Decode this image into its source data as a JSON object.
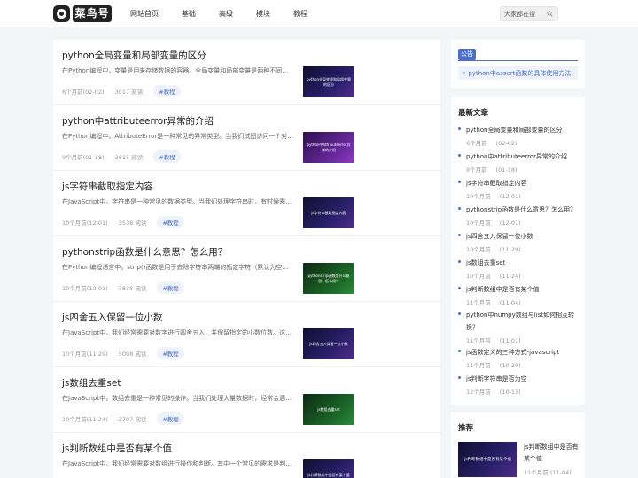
{
  "header": {
    "logo_text": "菜鸟号",
    "nav": [
      "网站首页",
      "基础",
      "高级",
      "模块",
      "教程"
    ],
    "search_placeholder": "大家都在搜"
  },
  "articles": [
    {
      "title": "python全局变量和局部变量的区分",
      "summary": "在Python编程中，变量是用来存储数据的容器。全局变量和局部变量是两种不同的…",
      "time": "6个月前(02-02)",
      "views": "3017 阅读",
      "tag": "#教程",
      "thumb": "python全局变量和局部变量的区分"
    },
    {
      "title": "python中attributeerror异常的介绍",
      "summary": "在Python编程中，AttributeError是一种常见的异常类型。当我们试图访问一个对象…",
      "time": "9个月前(01-18)",
      "views": "3615 阅读",
      "tag": "#教程",
      "thumb": "python中attributeerror异常的介绍"
    },
    {
      "title": "js字符串截取指定内容",
      "summary": "在JavaScript中，字符串是一种常见的数据类型。当我们处理字符串时，有时候需…",
      "time": "10个月前(12-01)",
      "views": "3538 阅读",
      "tag": "#教程",
      "thumb": "js字符串截取指定内容"
    },
    {
      "title": "pythonstrip函数是什么意思？怎么用？",
      "summary": "在Python编程语言中，strip()函数是用于去除字符串两端的指定字符（默认为空格…",
      "time": "10个月前(12-01)",
      "views": "3835 阅读",
      "tag": "#教程",
      "thumb": "pythonstrip函数是什么意思？怎么用？"
    },
    {
      "title": "js四舍五入保留一位小数",
      "summary": "在JavaScript中，我们经常需要对数字进行四舍五入，并保留指定的小数位数。这…",
      "time": "10个月前(11-29)",
      "views": "5098 阅读",
      "tag": "#教程",
      "thumb": "js四舍五入保留一位小数"
    },
    {
      "title": "js数组去重set",
      "summary": "在JavaScript中，数组去重是一种常见的操作。当我们处理大量数据时，经常会遇…",
      "time": "10个月前(11-24)",
      "views": "3707 阅读",
      "tag": "#教程",
      "thumb": "js数组去重set"
    },
    {
      "title": "js判断数组中是否有某个值",
      "summary": "在JavaScript中，我们经常需要对数组进行操作和判断。其中一个常见的需求是判…",
      "time": "",
      "views": "",
      "tag": "",
      "thumb": "js判断数组中是否有某个值"
    }
  ],
  "sidebar": {
    "notice_label": "公告",
    "notice_item": "python中assert函数的具体使用方法",
    "latest_title": "最新文章",
    "latest": [
      {
        "title": "python全局变量和局部变量的区分",
        "ago": "6个月前",
        "date": "(02-02)"
      },
      {
        "title": "python中attributeerror异常的介绍",
        "ago": "9个月前",
        "date": "(01-18)"
      },
      {
        "title": "js字符串截取指定内容",
        "ago": "10个月前",
        "date": "(12-01)"
      },
      {
        "title": "pythonstrip函数是什么意思？怎么用？",
        "ago": "10个月前",
        "date": "(12-01)"
      },
      {
        "title": "js四舍五入保留一位小数",
        "ago": "10个月前",
        "date": "(11-29)"
      },
      {
        "title": "js数组去重set",
        "ago": "10个月前",
        "date": "(11-24)"
      },
      {
        "title": "js判断数组中是否有某个值",
        "ago": "11个月前",
        "date": "(11-04)"
      },
      {
        "title": "python中numpy数组与list如何相互转换？",
        "ago": "11个月前",
        "date": "(11-01)"
      },
      {
        "title": "js函数定义的三种方式-javascript",
        "ago": "11个月前",
        "date": "(10-29)"
      },
      {
        "title": "js判断字符串是否为空",
        "ago": "12个月前",
        "date": "(10-13)"
      }
    ],
    "recommend_title": "推荐",
    "recommend": {
      "title": "js判断数组中是否有某个值",
      "date": "11个月前 (11-04)",
      "thumb": "js判断数组中是否有某个值"
    }
  },
  "colors": {
    "accent": "#4a6fd1"
  }
}
